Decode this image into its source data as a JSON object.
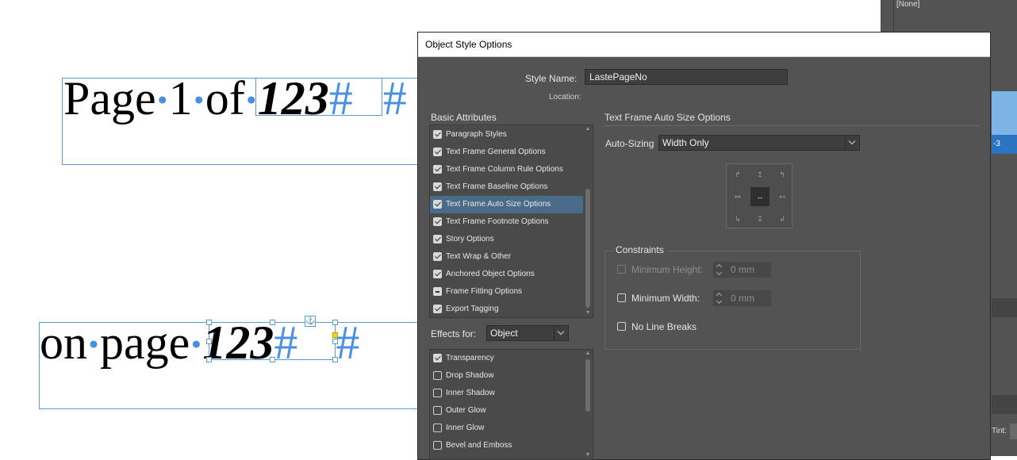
{
  "canvas": {
    "line1": {
      "prefix_words": [
        "Page",
        "1",
        "of"
      ],
      "number": "123",
      "hash1": "#",
      "hash2": "#"
    },
    "line2": {
      "prefix_words": [
        "on",
        "page"
      ],
      "number": "123",
      "hash1": "#",
      "hash2": "#"
    }
  },
  "right_panel": {
    "swatch_none": "[None]",
    "selected_suffix": "-3",
    "tint_label": "Tint:"
  },
  "dialog": {
    "title": "Object Style Options",
    "style_name_label": "Style Name:",
    "style_name_value": "LastePageNo",
    "location_label": "Location:",
    "basic_attributes_title": "Basic Attributes",
    "basic_attributes": [
      {
        "label": "Paragraph Styles",
        "state": "checked"
      },
      {
        "label": "Text Frame General Options",
        "state": "checked"
      },
      {
        "label": "Text Frame Column Rule Options",
        "state": "checked"
      },
      {
        "label": "Text Frame Baseline Options",
        "state": "checked"
      },
      {
        "label": "Text Frame Auto Size Options",
        "state": "checked",
        "selected": true
      },
      {
        "label": "Text Frame Footnote Options",
        "state": "checked"
      },
      {
        "label": "Story Options",
        "state": "checked"
      },
      {
        "label": "Text Wrap & Other",
        "state": "checked"
      },
      {
        "label": "Anchored Object Options",
        "state": "checked"
      },
      {
        "label": "Frame Fitting Options",
        "state": "mixed"
      },
      {
        "label": "Export Tagging",
        "state": "checked"
      }
    ],
    "effects_for_label": "Effects for:",
    "effects_for_value": "Object",
    "effects": [
      {
        "label": "Transparency",
        "state": "checked"
      },
      {
        "label": "Drop Shadow",
        "state": "unchecked"
      },
      {
        "label": "Inner Shadow",
        "state": "unchecked"
      },
      {
        "label": "Outer Glow",
        "state": "unchecked"
      },
      {
        "label": "Inner Glow",
        "state": "unchecked"
      },
      {
        "label": "Bevel and Emboss",
        "state": "unchecked"
      }
    ],
    "auto_size": {
      "section_title": "Text Frame Auto Size Options",
      "auto_sizing_label": "Auto-Sizing",
      "auto_sizing_value": "Width Only",
      "reference_points": [
        "↱",
        "↥",
        "↰",
        "↦",
        "↔",
        "↤",
        "↳",
        "↧",
        "↲"
      ],
      "active_reference_index": 4,
      "constraints_title": "Constraints",
      "min_height_label": "Minimum Height:",
      "min_height_value": "0 mm",
      "min_width_label": "Minimum Width:",
      "min_width_value": "0 mm",
      "no_line_breaks_label": "No Line Breaks"
    }
  },
  "colors": {
    "frame_blue": "#5b9bd5",
    "dialog_bg": "#535353",
    "selected_row": "#4a6a8a"
  }
}
